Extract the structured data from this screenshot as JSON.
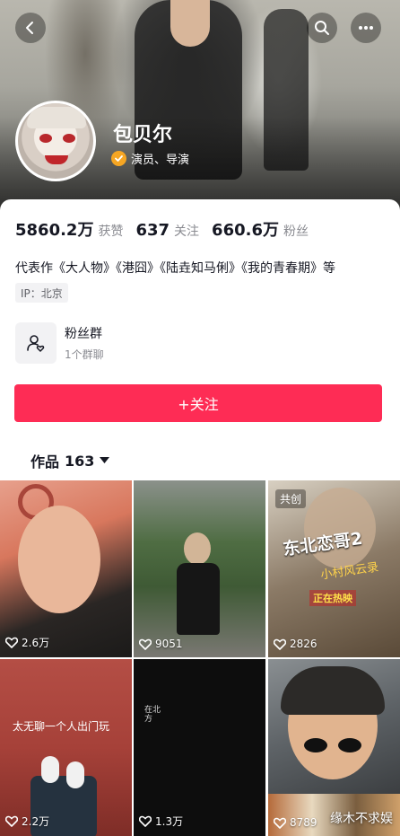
{
  "profile": {
    "name": "包贝尔",
    "verify_text": "演员、导演"
  },
  "stats": [
    {
      "value": "5860.2万",
      "label": "获赞"
    },
    {
      "value": "637",
      "label": "关注"
    },
    {
      "value": "660.6万",
      "label": "粉丝"
    }
  ],
  "bio": "代表作《大人物》《港囧》《陆垚知马俐》《我的青春期》等",
  "ip": "IP：北京",
  "fan_group": {
    "title": "粉丝群",
    "subtitle": "1个群聊"
  },
  "follow_label": "+关注",
  "works": {
    "label": "作品",
    "count": "163"
  },
  "videos": [
    {
      "likes": "2.6万"
    },
    {
      "likes": "9051"
    },
    {
      "likes": "2826",
      "badge": "共创",
      "poster_title": "东北恋哥2",
      "poster_subtitle": "小村风云录",
      "poster_status": "正在热映"
    },
    {
      "likes": "2.2万",
      "caption": "太无聊一个人出门玩"
    },
    {
      "likes": "1.3万",
      "mini_text": "在北方"
    },
    {
      "likes": "8789"
    }
  ],
  "watermark": "缘木不求娱",
  "colors": {
    "accent": "#fe2c55",
    "verify": "#f6a623"
  },
  "icons": {
    "back": "chevron-left-icon",
    "search": "search-icon",
    "more": "more-dots-icon",
    "verify": "verified-check-icon",
    "fan_group": "group-chat-icon",
    "works_dropdown": "triangle-down-icon",
    "like": "heart-outline-icon"
  }
}
